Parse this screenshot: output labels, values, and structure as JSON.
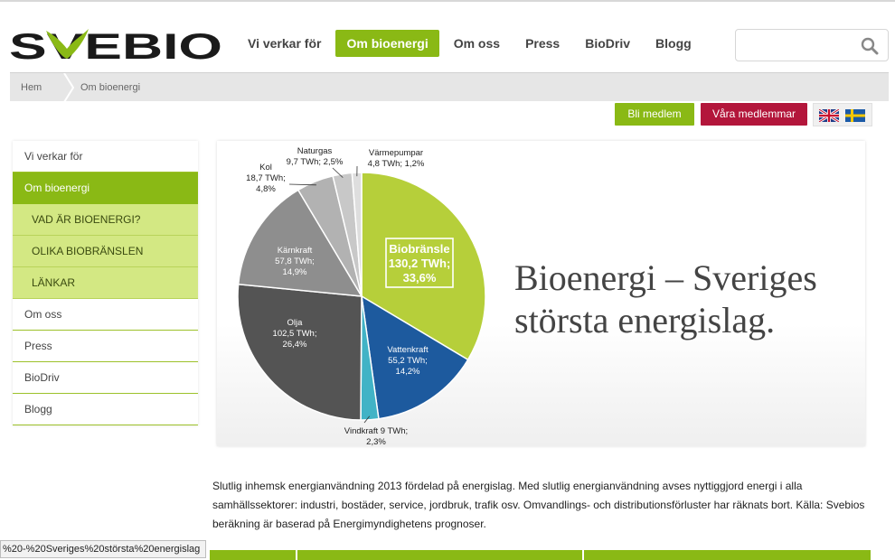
{
  "header": {
    "logo_text": "SVEBIO",
    "nav": [
      {
        "label": "Vi verkar för",
        "active": false
      },
      {
        "label": "Om bioenergi",
        "active": true
      },
      {
        "label": "Om oss",
        "active": false
      },
      {
        "label": "Press",
        "active": false
      },
      {
        "label": "BioDriv",
        "active": false
      },
      {
        "label": "Blogg",
        "active": false
      }
    ],
    "search": {
      "value": "",
      "placeholder": "",
      "icon": "magnifier-icon"
    }
  },
  "breadcrumb": {
    "home": "Hem",
    "current": "Om bioenergi"
  },
  "actions": {
    "join_label": "Bli medlem",
    "members_label": "Våra medlemmar",
    "flags": [
      "uk-flag-icon",
      "sweden-flag-icon"
    ]
  },
  "sidebar": {
    "items": [
      {
        "label": "Vi verkar för",
        "type": "normal"
      },
      {
        "label": "Om bioenergi",
        "type": "active"
      },
      {
        "label": "VAD ÄR BIOENERGI?",
        "type": "sub"
      },
      {
        "label": "OLIKA BIOBRÄNSLEN",
        "type": "sub"
      },
      {
        "label": "LÄNKAR",
        "type": "sub"
      },
      {
        "label": "Om oss",
        "type": "normal"
      },
      {
        "label": "Press",
        "type": "normal"
      },
      {
        "label": "BioDriv",
        "type": "normal"
      },
      {
        "label": "Blogg",
        "type": "normal"
      }
    ]
  },
  "headline": {
    "line1": "Bioenergi – Sveriges",
    "line2": "största energislag."
  },
  "chart_data": {
    "type": "pie",
    "unit": "TWh",
    "slices": [
      {
        "name": "Biobränsle",
        "value": 130.2,
        "percent": 33.6,
        "value_label": "130,2 TWh;",
        "percent_label": "33,6%",
        "color": "#b6cf3a"
      },
      {
        "name": "Vattenkraft",
        "value": 55.2,
        "percent": 14.2,
        "value_label": "55,2 TWh;",
        "percent_label": "14,2%",
        "color": "#1d5a9e"
      },
      {
        "name": "Vindkraft",
        "value": 9,
        "percent": 2.3,
        "value_label": "9 TWh;",
        "percent_label": "2,3%",
        "color": "#41b3c6"
      },
      {
        "name": "Olja",
        "value": 102.5,
        "percent": 26.4,
        "value_label": "102,5 TWh;",
        "percent_label": "26,4%",
        "color": "#545454"
      },
      {
        "name": "Kärnkraft",
        "value": 57.8,
        "percent": 14.9,
        "value_label": "57,8 TWh;",
        "percent_label": "14,9%",
        "color": "#8e8e8e"
      },
      {
        "name": "Kol",
        "value": 18.7,
        "percent": 4.8,
        "value_label": "18,7 TWh;",
        "percent_label": "4,8%",
        "color": "#b2b2b2"
      },
      {
        "name": "Naturgas",
        "value": 9.7,
        "percent": 2.5,
        "value_label": "9,7 TWh; 2,5%",
        "percent_label": "",
        "color": "#c8c8c8"
      },
      {
        "name": "Värmepumpar",
        "value": 4.8,
        "percent": 1.2,
        "value_label": "4,8 TWh; 1,2%",
        "percent_label": "",
        "color": "#dedede"
      }
    ]
  },
  "caption": "Slutlig inhemsk energianvändning 2013 fördelad på energislag. Med slutlig energianvändning avses nyttiggjord energi i alla samhällssektorer: industri, bostäder, service, jordbruk, trafik osv. Omvandlings- och distributionsförluster har räknats bort. Källa: Svebios beräkning är baserad på Energimyndighetens prognoser.",
  "status_url": "%20-%20Sveriges%20största%20energislag",
  "colors": {
    "brand_green": "#8ab915",
    "brand_red": "#b3163b",
    "sub_green": "#d3e883"
  }
}
